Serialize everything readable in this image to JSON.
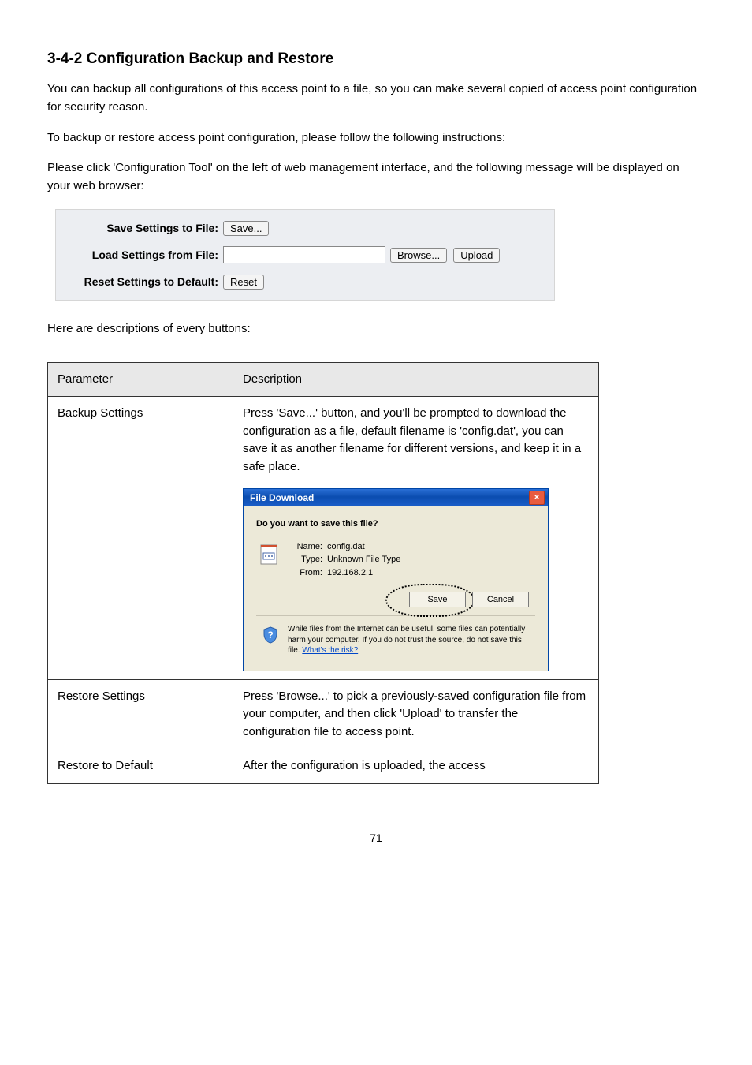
{
  "section": {
    "heading": "3-4-2 Configuration Backup and Restore",
    "intro": "You can backup all configurations of this access point to a file, so you can make several copied of access point configuration for security reason.",
    "usage": "To backup or restore access point configuration, please follow the following instructions:",
    "nav": "Please click 'Configuration Tool' on the left of web management interface, and the following message will be displayed on your web browser:"
  },
  "panel": {
    "save_label": "Save Settings to File:",
    "save_btn": "Save...",
    "load_label": "Load Settings from File:",
    "browse_btn": "Browse...",
    "upload_btn": "Upload",
    "reset_label": "Reset Settings to Default:",
    "reset_btn": "Reset"
  },
  "table_intro": "Here are descriptions of every buttons:",
  "table": {
    "h1": "Parameter",
    "h2": "Description",
    "rows": [
      {
        "label": "Backup Settings",
        "desc_before": "Press 'Save...' button, and you'll be prompted to download the configuration as a file, default filename is 'config.dat', you can save it as another filename for different versions, and keep it in a safe place.",
        "dialog": {
          "title": "File Download",
          "question": "Do you want to save this file?",
          "name_label": "Name:",
          "name_value": "config.dat",
          "type_label": "Type:",
          "type_value": "Unknown File Type",
          "from_label": "From:",
          "from_value": "192.168.2.1",
          "save_btn": "Save",
          "cancel_btn": "Cancel",
          "warn_text": "While files from the Internet can be useful, some files can potentially harm your computer. If you do not trust the source, do not save this file. ",
          "risk_link": "What's the risk?"
        }
      },
      {
        "label": "Restore Settings",
        "desc": "Press 'Browse...' to pick a previously-saved configuration file from your computer, and then click 'Upload' to transfer the configuration file to access point."
      },
      {
        "label": "Restore to Default",
        "desc": "After the configuration is uploaded, the access"
      }
    ]
  },
  "footer": "71"
}
